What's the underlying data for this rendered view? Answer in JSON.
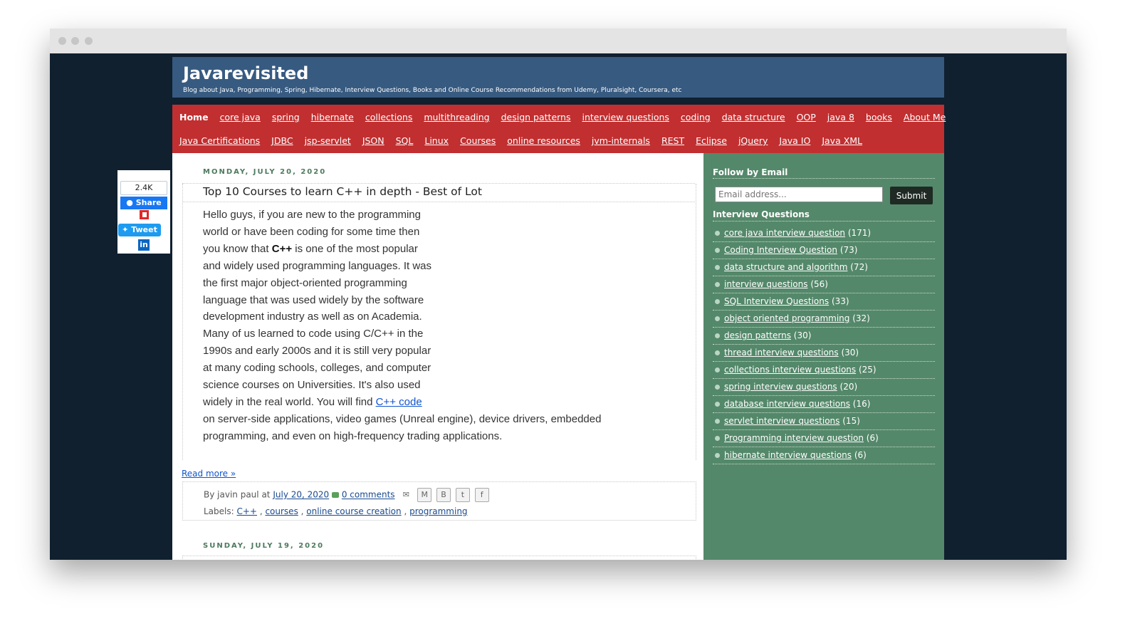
{
  "blog": {
    "title": "Javarevisited",
    "description": "Blog about Java, Programming, Spring, Hibernate, Interview Questions, Books and Online Course Recommendations from Udemy, Pluralsight, Coursera, etc"
  },
  "nav": {
    "row1": [
      "Home",
      "core java",
      "spring",
      "hibernate",
      "collections",
      "multithreading",
      "design patterns",
      "interview questions",
      "coding",
      "data structure",
      "OOP",
      "java 8",
      "books",
      "About Me"
    ],
    "row2": [
      "Java Certifications",
      "JDBC",
      "jsp-servlet",
      "JSON",
      "SQL",
      "Linux",
      "Courses",
      "online resources",
      "jvm-internals",
      "REST",
      "Eclipse",
      "jQuery",
      "Java IO",
      "Java XML"
    ]
  },
  "share": {
    "count": "2.4K",
    "facebook": "Share",
    "twitter": "Tweet",
    "linkedin": "in"
  },
  "post": {
    "date": "MONDAY, JULY 20, 2020",
    "title": "Top 10 Courses to learn C++ in depth - Best of Lot",
    "lines": [
      "Hello guys, if you are new to the programming",
      "world or have been coding for some time then",
      "you know that",
      "is one of the most popular",
      "and widely used programming languages. It was",
      "the first major object-oriented programming",
      "language that was used widely by the software",
      "development industry as well as on Academia.",
      "Many of us learned to code using C/C++ in the",
      "1990s and early 2000s and it is still very popular",
      "at many coding schools, colleges, and computer",
      "science courses on Universities. It's also used",
      "widely in the real world. You will find",
      "on server-side applications, video games (Unreal engine), device drivers, embedded",
      "programming, and even on high-frequency trading applications."
    ],
    "bold_term": "C++",
    "link_text": "C++ code",
    "read_more": "Read more »",
    "by": "By",
    "author": "javin paul",
    "at": "at",
    "date_link": "July 20, 2020",
    "comments": "0 comments",
    "labels_prefix": "Labels:",
    "labels": [
      "C++",
      "courses",
      "online course creation",
      "programming"
    ]
  },
  "next_post": {
    "date": "SUNDAY, JULY 19, 2020"
  },
  "sidebar": {
    "follow_title": "Follow by Email",
    "email_placeholder": "Email address...",
    "submit": "Submit",
    "iq_title": "Interview Questions",
    "items": [
      {
        "label": "core java interview question",
        "count": "(171)"
      },
      {
        "label": "Coding Interview Question",
        "count": "(73)"
      },
      {
        "label": "data structure and algorithm",
        "count": "(72)"
      },
      {
        "label": "interview questions",
        "count": "(56)"
      },
      {
        "label": "SQL Interview Questions",
        "count": "(33)"
      },
      {
        "label": "object oriented programming",
        "count": "(32)"
      },
      {
        "label": "design patterns",
        "count": "(30)"
      },
      {
        "label": "thread interview questions",
        "count": "(30)"
      },
      {
        "label": "collections interview questions",
        "count": "(25)"
      },
      {
        "label": "spring interview questions",
        "count": "(20)"
      },
      {
        "label": "database interview questions",
        "count": "(16)"
      },
      {
        "label": "servlet interview questions",
        "count": "(15)"
      },
      {
        "label": "Programming interview question",
        "count": "(6)"
      },
      {
        "label": "hibernate interview questions",
        "count": "(6)"
      }
    ]
  }
}
